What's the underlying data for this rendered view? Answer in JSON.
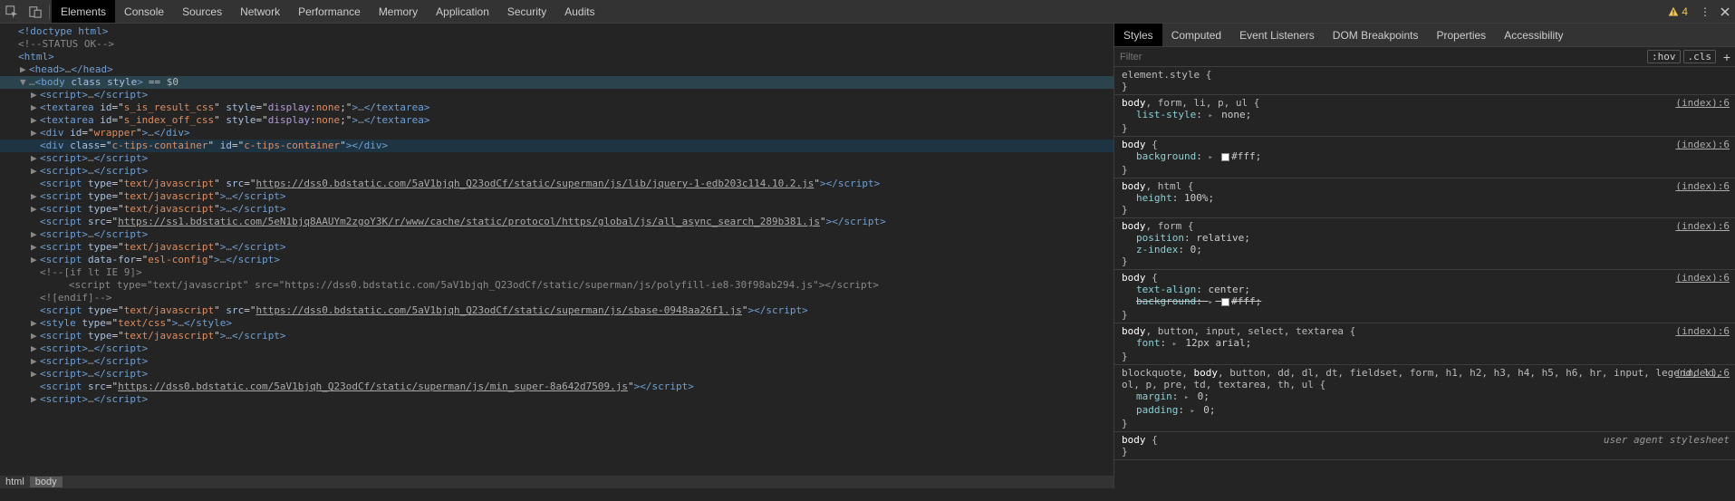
{
  "toolbar": {
    "tabs": [
      "Elements",
      "Console",
      "Sources",
      "Network",
      "Performance",
      "Memory",
      "Application",
      "Security",
      "Audits"
    ],
    "active_tab": 0,
    "warn_count": "4"
  },
  "dom": {
    "lines": [
      {
        "d": 0,
        "tri": "",
        "html": "<span class='tag-b'>&lt;!doctype html&gt;</span>"
      },
      {
        "d": 0,
        "tri": "",
        "html": "<span class='comment'>&lt;!--STATUS OK--&gt;</span>"
      },
      {
        "d": 0,
        "tri": "",
        "html": "<span class='tag-b'>&lt;html&gt;</span>"
      },
      {
        "d": 1,
        "tri": "▶",
        "html": "<span class='tag-b'>&lt;head&gt;</span><span class='dim'>…</span><span class='tag-b'>&lt;/head&gt;</span>"
      },
      {
        "d": 1,
        "tri": "▼",
        "sel": true,
        "html": "<span class='dim'>…</span><span class='tag-b'>&lt;body </span><span class='attr-n'>class style</span><span class='tag-b'>&gt;</span><span class='sel-suffix'>== $0</span>"
      },
      {
        "d": 2,
        "tri": "▶",
        "html": "<span class='tag-b'>&lt;script&gt;</span><span class='dim'>…</span><span class='tag-b'>&lt;/script&gt;</span>"
      },
      {
        "d": 2,
        "tri": "▶",
        "html": "<span class='tag-b'>&lt;textarea </span><span class='attr-n'>id</span><span class='eq'>=&quot;</span><span class='attr-v'>s_is_result_css</span><span class='eq'>&quot; </span><span class='attr-n'>style</span><span class='eq'>=&quot;</span><span class='css-kw'>display</span><span class='eq'>:</span><span class='attr-v'>none</span><span class='eq'>;&quot;</span><span class='tag-b'>&gt;</span><span class='dim'>…</span><span class='tag-b'>&lt;/textarea&gt;</span>"
      },
      {
        "d": 2,
        "tri": "▶",
        "html": "<span class='tag-b'>&lt;textarea </span><span class='attr-n'>id</span><span class='eq'>=&quot;</span><span class='attr-v'>s_index_off_css</span><span class='eq'>&quot; </span><span class='attr-n'>style</span><span class='eq'>=&quot;</span><span class='css-kw'>display</span><span class='eq'>:</span><span class='attr-v'>none</span><span class='eq'>;&quot;</span><span class='tag-b'>&gt;</span><span class='dim'>…</span><span class='tag-b'>&lt;/textarea&gt;</span>"
      },
      {
        "d": 2,
        "tri": "▶",
        "html": "<span class='tag-b'>&lt;div </span><span class='attr-n'>id</span><span class='eq'>=&quot;</span><span class='attr-v'>wrapper</span><span class='eq'>&quot;</span><span class='tag-b'>&gt;</span><span class='dim'>…</span><span class='tag-b'>&lt;/div&gt;</span>"
      },
      {
        "d": 2,
        "tri": "",
        "hi": true,
        "html": "<span class='tag-b'>&lt;div </span><span class='attr-n'>class</span><span class='eq'>=&quot;</span><span class='attr-v'>c-tips-container</span><span class='eq'>&quot; </span><span class='attr-n'>id</span><span class='eq'>=&quot;</span><span class='attr-v'>c-tips-container</span><span class='eq'>&quot;</span><span class='tag-b'>&gt;&lt;/div&gt;</span>"
      },
      {
        "d": 2,
        "tri": "▶",
        "html": "<span class='tag-b'>&lt;script&gt;</span><span class='dim'>…</span><span class='tag-b'>&lt;/script&gt;</span>"
      },
      {
        "d": 2,
        "tri": "▶",
        "html": "<span class='tag-b'>&lt;script&gt;</span><span class='dim'>…</span><span class='tag-b'>&lt;/script&gt;</span>"
      },
      {
        "d": 2,
        "tri": "",
        "html": "<span class='tag-b'>&lt;script </span><span class='attr-n'>type</span><span class='eq'>=&quot;</span><span class='attr-v'>text/javascript</span><span class='eq'>&quot; </span><span class='attr-n'>src</span><span class='eq'>=&quot;</span><span class='str-url'>https://dss0.bdstatic.com/5aV1bjqh_Q23odCf/static/superman/js/lib/jquery-1-edb203c114.10.2.js</span><span class='eq'>&quot;</span><span class='tag-b'>&gt;&lt;/script&gt;</span>"
      },
      {
        "d": 2,
        "tri": "▶",
        "html": "<span class='tag-b'>&lt;script </span><span class='attr-n'>type</span><span class='eq'>=&quot;</span><span class='attr-v'>text/javascript</span><span class='eq'>&quot;</span><span class='tag-b'>&gt;</span><span class='dim'>…</span><span class='tag-b'>&lt;/script&gt;</span>"
      },
      {
        "d": 2,
        "tri": "▶",
        "html": "<span class='tag-b'>&lt;script </span><span class='attr-n'>type</span><span class='eq'>=&quot;</span><span class='attr-v'>text/javascript</span><span class='eq'>&quot;</span><span class='tag-b'>&gt;</span><span class='dim'>…</span><span class='tag-b'>&lt;/script&gt;</span>"
      },
      {
        "d": 2,
        "tri": "",
        "html": "<span class='tag-b'>&lt;script </span><span class='attr-n'>src</span><span class='eq'>=&quot;</span><span class='str-url'>https://ss1.bdstatic.com/5eN1bjq8AAUYm2zgoY3K/r/www/cache/static/protocol/https/global/js/all_async_search_289b381.js</span><span class='eq'>&quot;</span><span class='tag-b'>&gt;&lt;/script&gt;</span>"
      },
      {
        "d": 2,
        "tri": "▶",
        "html": "<span class='tag-b'>&lt;script&gt;</span><span class='dim'>…</span><span class='tag-b'>&lt;/script&gt;</span>"
      },
      {
        "d": 2,
        "tri": "▶",
        "html": "<span class='tag-b'>&lt;script </span><span class='attr-n'>type</span><span class='eq'>=&quot;</span><span class='attr-v'>text/javascript</span><span class='eq'>&quot;</span><span class='tag-b'>&gt;</span><span class='dim'>…</span><span class='tag-b'>&lt;/script&gt;</span>"
      },
      {
        "d": 2,
        "tri": "▶",
        "html": "<span class='tag-b'>&lt;script </span><span class='attr-n'>data-for</span><span class='eq'>=&quot;</span><span class='attr-v'>esl-config</span><span class='eq'>&quot;</span><span class='tag-b'>&gt;</span><span class='dim'>…</span><span class='tag-b'>&lt;/script&gt;</span>"
      },
      {
        "d": 2,
        "tri": "",
        "html": "<span class='comment'>&lt;!--[if lt IE 9]&gt;</span>"
      },
      {
        "d": 3,
        "tri": "",
        "html": "<span class='comment'>   &lt;script type=&quot;text/javascript&quot; src=&quot;https://dss0.bdstatic.com/5aV1bjqh_Q23odCf/static/superman/js/polyfill-ie8-30f98ab294.js&quot;&gt;&lt;/script&gt;</span>"
      },
      {
        "d": 2,
        "tri": "",
        "html": "<span class='comment'>&lt;![endif]--&gt;</span>"
      },
      {
        "d": 2,
        "tri": "",
        "html": "<span class='tag-b'>&lt;script </span><span class='attr-n'>type</span><span class='eq'>=&quot;</span><span class='attr-v'>text/javascript</span><span class='eq'>&quot; </span><span class='attr-n'>src</span><span class='eq'>=&quot;</span><span class='str-url'>https://dss0.bdstatic.com/5aV1bjqh_Q23odCf/static/superman/js/sbase-0948aa26f1.js</span><span class='eq'>&quot;</span><span class='tag-b'>&gt;&lt;/script&gt;</span>"
      },
      {
        "d": 2,
        "tri": "▶",
        "html": "<span class='tag-b'>&lt;style </span><span class='attr-n'>type</span><span class='eq'>=&quot;</span><span class='attr-v'>text/css</span><span class='eq'>&quot;</span><span class='tag-b'>&gt;</span><span class='dim'>…</span><span class='tag-b'>&lt;/style&gt;</span>"
      },
      {
        "d": 2,
        "tri": "▶",
        "html": "<span class='tag-b'>&lt;script </span><span class='attr-n'>type</span><span class='eq'>=&quot;</span><span class='attr-v'>text/javascript</span><span class='eq'>&quot;</span><span class='tag-b'>&gt;</span><span class='dim'>…</span><span class='tag-b'>&lt;/script&gt;</span>"
      },
      {
        "d": 2,
        "tri": "▶",
        "html": "<span class='tag-b'>&lt;script&gt;</span><span class='dim'>…</span><span class='tag-b'>&lt;/script&gt;</span>"
      },
      {
        "d": 2,
        "tri": "▶",
        "html": "<span class='tag-b'>&lt;script&gt;</span><span class='dim'>…</span><span class='tag-b'>&lt;/script&gt;</span>"
      },
      {
        "d": 2,
        "tri": "▶",
        "html": "<span class='tag-b'>&lt;script&gt;</span><span class='dim'>…</span><span class='tag-b'>&lt;/script&gt;</span>"
      },
      {
        "d": 2,
        "tri": "",
        "html": "<span class='tag-b'>&lt;script </span><span class='attr-n'>src</span><span class='eq'>=&quot;</span><span class='str-url'>https://dss0.bdstatic.com/5aV1bjqh_Q23odCf/static/superman/js/min_super-8a642d7509.js</span><span class='eq'>&quot;</span><span class='tag-b'>&gt;&lt;/script&gt;</span>"
      },
      {
        "d": 2,
        "tri": "▶",
        "html": "<span class='tag-b'>&lt;script&gt;</span><span class='dim'>…</span><span class='tag-b'>&lt;/script&gt;</span>"
      }
    ]
  },
  "crumbs": [
    "html",
    "body"
  ],
  "side": {
    "tabs": [
      "Styles",
      "Computed",
      "Event Listeners",
      "DOM Breakpoints",
      "Properties",
      "Accessibility"
    ],
    "active_tab": 0,
    "filter_placeholder": "Filter",
    "hov": ":hov",
    "cls": ".cls"
  },
  "styles": {
    "src_label": "(index):6",
    "ua_label": "user agent stylesheet",
    "rules": [
      {
        "selector": "element.style",
        "emph": "",
        "src": "",
        "decls": []
      },
      {
        "selector": ", form, li, p, ul",
        "emph": "body",
        "src": "(index):6",
        "decls": [
          {
            "n": "list-style",
            "v": "none",
            "tri": true
          }
        ]
      },
      {
        "selector": "",
        "emph": "body",
        "src": "(index):6",
        "decls": [
          {
            "n": "background",
            "v": "#fff",
            "sw": true,
            "tri": true
          }
        ]
      },
      {
        "selector": ", html",
        "emph": "body",
        "src": "(index):6",
        "decls": [
          {
            "n": "height",
            "v": "100%"
          }
        ]
      },
      {
        "selector": ", form",
        "emph": "body",
        "src": "(index):6",
        "decls": [
          {
            "n": "position",
            "v": "relative"
          },
          {
            "n": "z-index",
            "v": "0"
          }
        ]
      },
      {
        "selector": "",
        "emph": "body",
        "src": "(index):6",
        "decls": [
          {
            "n": "text-align",
            "v": "center"
          },
          {
            "n": "background",
            "v": "#fff",
            "sw": true,
            "tri": true,
            "strike": true
          }
        ]
      },
      {
        "selector": ", button, input, select, textarea",
        "emph": "body",
        "src": "(index):6",
        "decls": [
          {
            "n": "font",
            "v": "12px arial",
            "tri": true
          }
        ]
      },
      {
        "selector": "blockquote, , button, dd, dl, dt, fieldset, form, h1, h2, h3, h4, h5, h6, hr, input, legend, li, ol, p, pre, td, textarea, th, ul",
        "emph": "body",
        "emph_pos": 1,
        "src": "(index):6",
        "decls": [
          {
            "n": "margin",
            "v": "0",
            "tri": true
          },
          {
            "n": "padding",
            "v": "0",
            "tri": true
          }
        ]
      },
      {
        "selector": "",
        "emph": "body",
        "src": "ua",
        "decls": []
      }
    ]
  }
}
